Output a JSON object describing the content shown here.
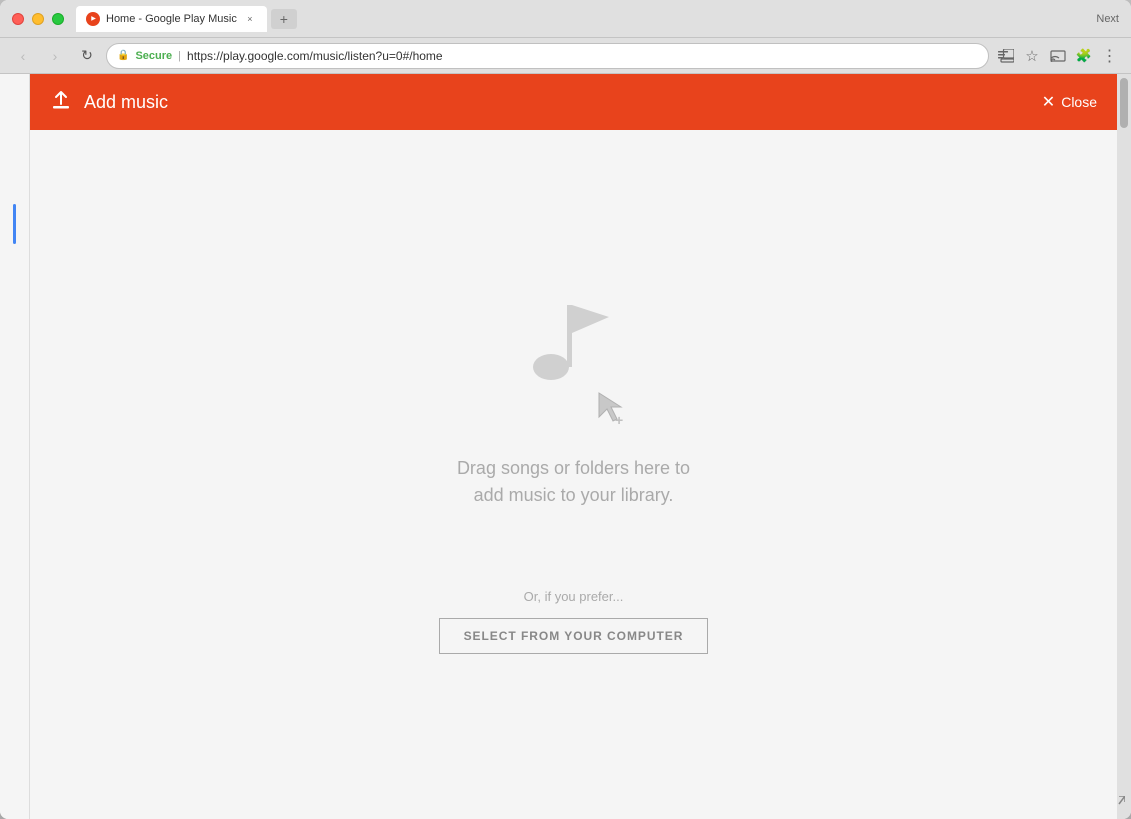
{
  "window": {
    "title_bar_right": "Next"
  },
  "tab": {
    "label": "Home - Google Play Music",
    "close_label": "×",
    "new_tab_label": "+"
  },
  "nav": {
    "back_label": "‹",
    "forward_label": "›",
    "refresh_label": "↻",
    "secure_label": "Secure",
    "address": "https://play.google.com/music/listen?u=0#/home",
    "cast_icon": "cast",
    "star_icon": "★",
    "cast2_icon": "⊡",
    "menu_icon": "⋮"
  },
  "panel": {
    "title": "Add music",
    "close_label": "Close",
    "upload_icon": "⬆",
    "close_icon": "×"
  },
  "drop_zone": {
    "drag_text": "Drag songs or folders here to\nadd music to your library.",
    "prefer_text": "Or, if you prefer...",
    "select_btn_label": "SELECT FROM YOUR COMPUTER"
  },
  "colors": {
    "header_bg": "#e8431c",
    "accent_blue": "#4285f4"
  }
}
